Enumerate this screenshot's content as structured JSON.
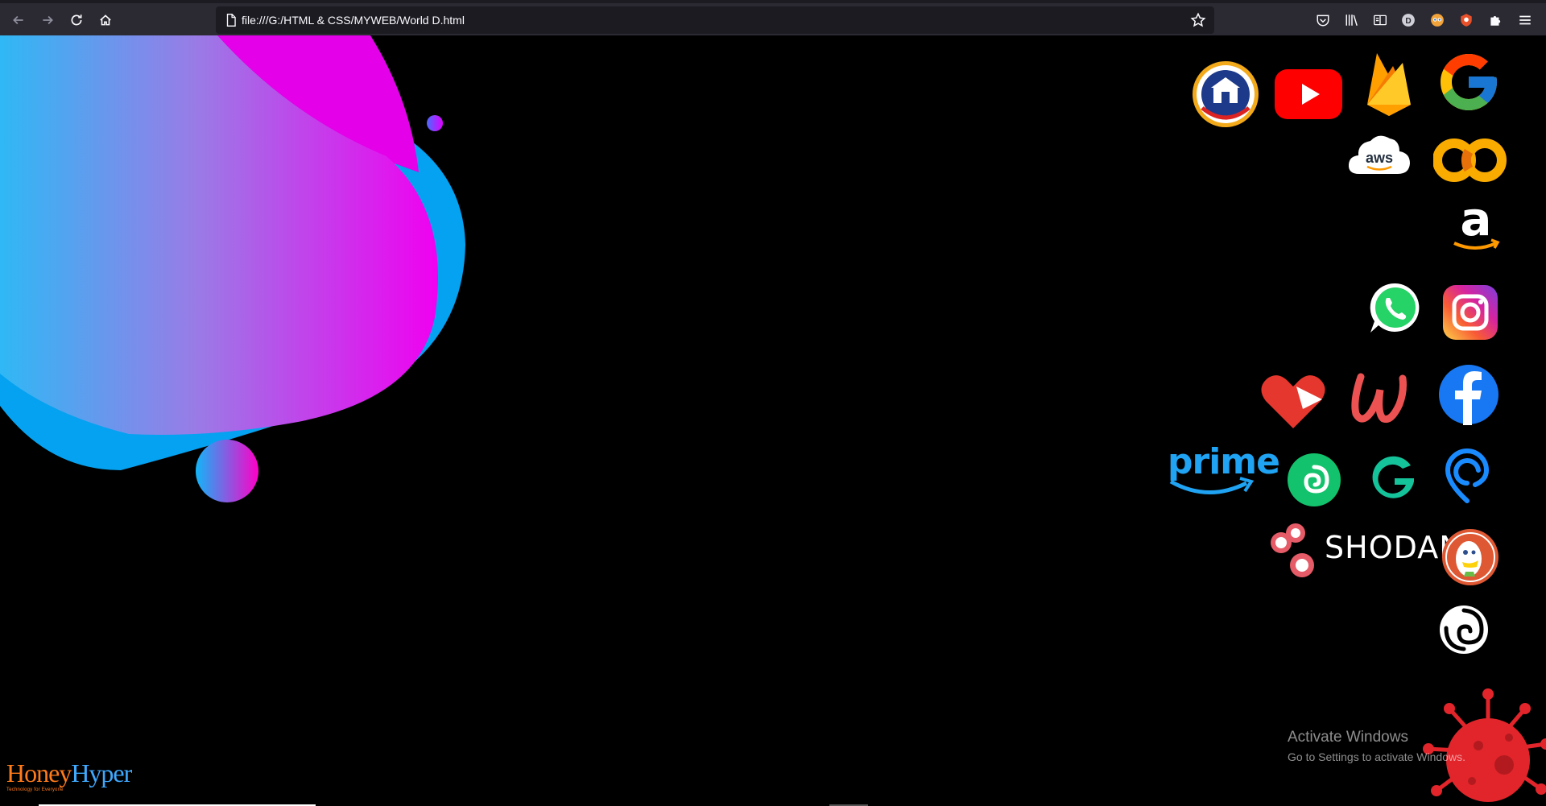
{
  "browser": {
    "url": "file:///G:/HTML & CSS/MYWEB/World D.html",
    "nav": {
      "back_icon": "arrow-left-icon",
      "forward_icon": "arrow-right-icon",
      "reload_icon": "reload-icon",
      "home_icon": "home-icon"
    },
    "toolbar_icons": [
      "pocket-icon",
      "library-icon",
      "reader-view-icon",
      "account-icon",
      "extension-icon",
      "extension-icon",
      "puzzle-icon",
      "menu-icon"
    ]
  },
  "page": {
    "background": "#000000",
    "logos": [
      "college-seal-logo",
      "youtube-logo",
      "firebase-logo",
      "google-logo",
      "aws-logo",
      "colab-logo",
      "amazon-logo",
      "whatsapp-logo",
      "instagram-logo",
      "pocket-heart-logo",
      "udemy-logo",
      "facebook-logo",
      "prime-logo",
      "swirl-logo",
      "grammarly-logo",
      "pin-logo",
      "shodan-logo",
      "duckduckgo-logo",
      "spiral-logo",
      "virus-graphic"
    ],
    "shodan_label": "SHODAN",
    "prime_label": "prime",
    "aws_label": "aws",
    "brand": {
      "name_part1": "Honey",
      "name_part2": "Hyper",
      "tagline": "Technology for Everyone"
    },
    "watermark": {
      "title": "Activate Windows",
      "subtitle": "Go to Settings to activate Windows."
    },
    "colors": {
      "toolbar": "#2b2a33",
      "urlbar": "#1c1b22",
      "youtube": "#ff0000",
      "facebook": "#1877f2",
      "whatsapp": "#25d366"
    }
  }
}
